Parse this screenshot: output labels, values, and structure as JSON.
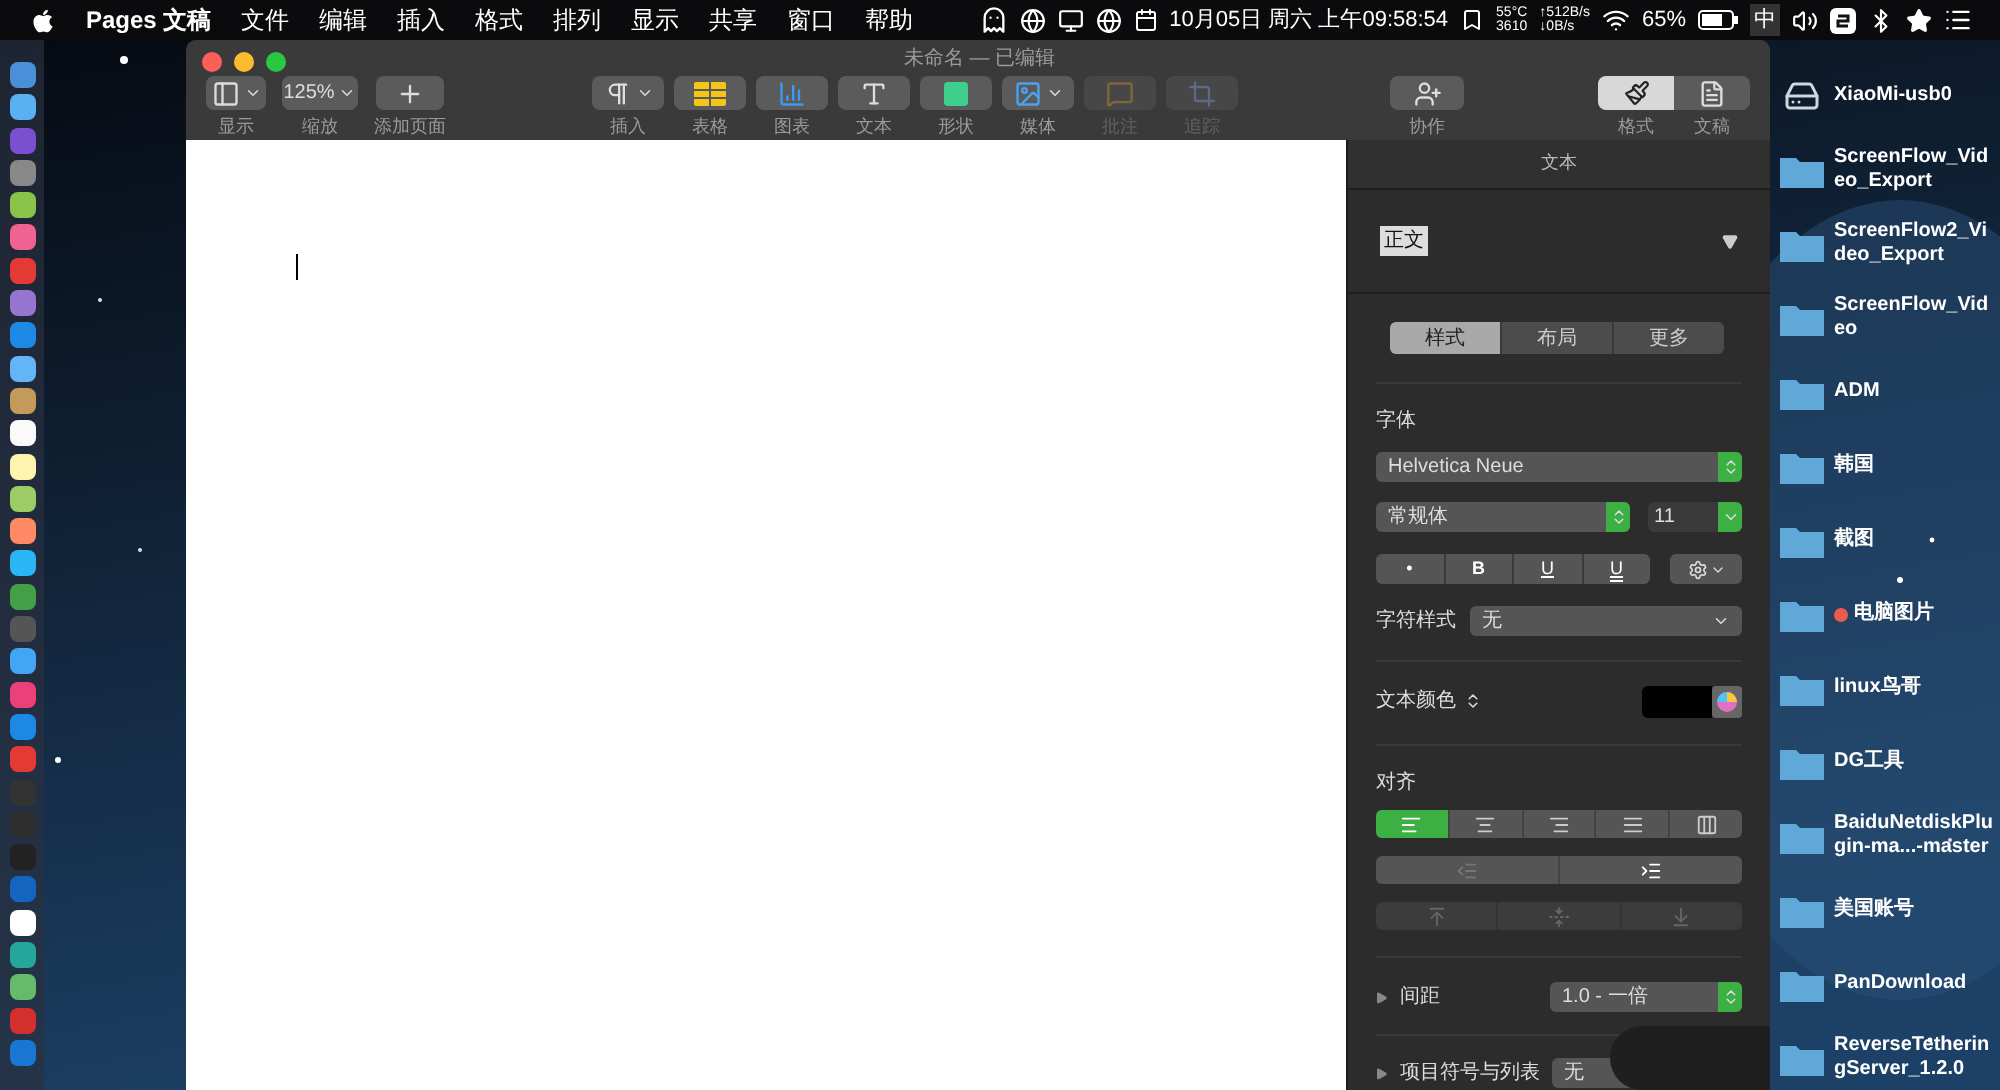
{
  "menubar": {
    "app": "Pages 文稿",
    "menus": [
      "文件",
      "编辑",
      "插入",
      "格式",
      "排列",
      "显示",
      "共享",
      "窗口",
      "帮助"
    ],
    "clock": "10月05日 周六 上午09:58:54",
    "temperature": "55°C",
    "fan_speed": "3610",
    "upload": "↑512B/s",
    "download": "↓0B/s",
    "battery": "65%",
    "input_method": "中"
  },
  "window": {
    "title": "未命名 — 已编辑"
  },
  "toolbar": {
    "left": [
      {
        "kind": "view",
        "label": "显示",
        "disabled": false
      },
      {
        "kind": "zoom",
        "value": "125%",
        "label": "缩放",
        "disabled": false
      },
      {
        "kind": "add-page",
        "label": "添加页面",
        "disabled": false
      }
    ],
    "center": [
      {
        "kind": "insert",
        "label": "插入",
        "disabled": false
      },
      {
        "kind": "table",
        "label": "表格",
        "disabled": false
      },
      {
        "kind": "chart",
        "label": "图表",
        "disabled": false
      },
      {
        "kind": "text",
        "label": "文本",
        "disabled": false
      },
      {
        "kind": "shape",
        "label": "形状",
        "disabled": false
      },
      {
        "kind": "media",
        "label": "媒体",
        "disabled": false
      },
      {
        "kind": "comment",
        "label": "批注",
        "disabled": true
      },
      {
        "kind": "track",
        "label": "追踪",
        "disabled": true
      }
    ],
    "collaborate": {
      "kind": "collaborate",
      "label": "协作",
      "disabled": false
    },
    "right": [
      {
        "kind": "format",
        "label": "格式",
        "selected": true
      },
      {
        "kind": "document",
        "label": "文稿",
        "selected": false
      }
    ]
  },
  "sidebar": {
    "header": "文本",
    "paragraph_style": "正文",
    "tabs": [
      {
        "label": "样式",
        "selected": true
      },
      {
        "label": "布局",
        "selected": false
      },
      {
        "label": "更多",
        "selected": false
      }
    ],
    "font_label": "字体",
    "font": "Helvetica Neue",
    "typeface": "常规体",
    "size": "11",
    "styles": [
      {
        "kind": "bullet",
        "label": "•"
      },
      {
        "kind": "bold",
        "label": "B"
      },
      {
        "kind": "underline",
        "label": "U"
      },
      {
        "kind": "double-underline",
        "label": "U"
      }
    ],
    "char_style_label": "字符样式",
    "char_style": "无",
    "color_label": "文本颜色",
    "align_label": "对齐",
    "alignments": [
      {
        "kind": "left",
        "selected": true
      },
      {
        "kind": "center",
        "selected": false
      },
      {
        "kind": "right",
        "selected": false
      },
      {
        "kind": "justify",
        "selected": false
      },
      {
        "kind": "auto",
        "selected": false
      }
    ],
    "indents": [
      {
        "kind": "decrease",
        "disabled": true
      },
      {
        "kind": "increase",
        "disabled": false
      }
    ],
    "vertical": [
      {
        "kind": "top",
        "disabled": true
      },
      {
        "kind": "middle",
        "disabled": true
      },
      {
        "kind": "bottom",
        "disabled": true
      }
    ],
    "spacing_label": "间距",
    "spacing_expanded": false,
    "spacing": "1.0 - 一倍",
    "list_label": "项目符号与列表",
    "list_expanded": false,
    "list_style": "无"
  },
  "desktop": [
    {
      "kind": "drive",
      "name": "XiaoMi-usb0"
    },
    {
      "kind": "folder",
      "name": "ScreenFlow_Video_Export"
    },
    {
      "kind": "folder",
      "name": "ScreenFlow2_Video_Export"
    },
    {
      "kind": "folder",
      "name": "ScreenFlow_Video"
    },
    {
      "kind": "folder",
      "name": "ADM"
    },
    {
      "kind": "folder",
      "name": "韩国"
    },
    {
      "kind": "folder",
      "name": "截图"
    },
    {
      "kind": "folder",
      "name": "电脑图片",
      "color": "#ec5b4f"
    },
    {
      "kind": "folder",
      "name": "linux鸟哥"
    },
    {
      "kind": "folder",
      "name": "DG工具"
    },
    {
      "kind": "folder",
      "name": "BaiduNetdiskPlugin-ma...-master"
    },
    {
      "kind": "folder",
      "name": "美国账号"
    },
    {
      "kind": "folder",
      "name": "PanDownload"
    },
    {
      "kind": "folder",
      "name": "ReverseTetheringServer_1.2.0"
    }
  ]
}
